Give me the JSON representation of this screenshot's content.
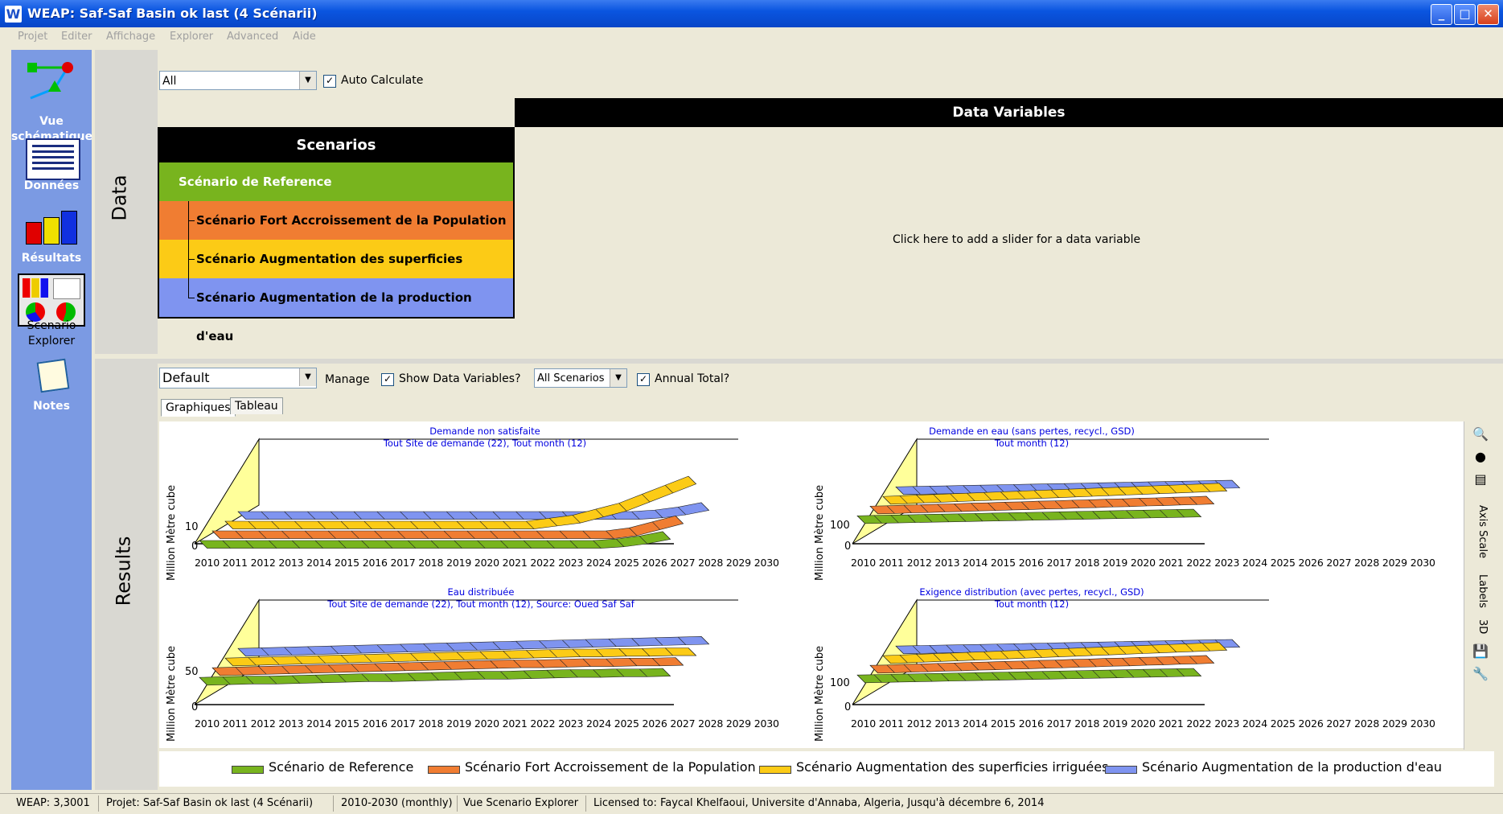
{
  "window": {
    "title": "WEAP: Saf-Saf  Basin ok last (4 Scénarii)",
    "logo_letter": "W"
  },
  "menu": [
    "Projet",
    "Editer",
    "Affichage",
    "Explorer",
    "Advanced",
    "Aide"
  ],
  "sidebar": {
    "items": [
      {
        "label": "Vue schématique",
        "icon": "schematic-icon"
      },
      {
        "label": "Données",
        "icon": "data-table-icon"
      },
      {
        "label": "Résultats",
        "icon": "bar-chart-icon"
      },
      {
        "label": "Scenario Explorer",
        "icon": "scenario-explorer-icon"
      },
      {
        "label": "Notes",
        "icon": "notes-icon"
      }
    ]
  },
  "data_section": {
    "label": "Data",
    "filter_value": "All",
    "auto_calculate_label": "Auto Calculate",
    "auto_calculate_checked": true,
    "data_variables_header": "Data Variables",
    "add_slider_hint": "Click here to add a slider for a data variable",
    "scenarios_title": "Scenarios",
    "scenarios": [
      {
        "name": "Scénario de Reference",
        "color": "#78b41e"
      },
      {
        "name": "Scénario Fort Accroissement de la Population",
        "color": "#f07d32"
      },
      {
        "name": "Scénario Augmentation des superficies irriguées",
        "color": "#fccb16"
      },
      {
        "name": "Scénario Augmentation de la production d'eau",
        "color": "#7f94f0"
      }
    ]
  },
  "results_section": {
    "label": "Results",
    "view_value": "Default",
    "manage_label": "Manage",
    "show_data_vars_label": "Show Data Variables?",
    "show_data_vars_checked": true,
    "scenario_filter_value": "All Scenarios",
    "annual_total_label": "Annual Total?",
    "annual_total_checked": true,
    "tabs": [
      "Graphiques",
      "Tableau"
    ],
    "active_tab": "Graphiques"
  },
  "charts": [
    {
      "title1": "Demande non satisfaite",
      "title2": "Tout Site de demande (22),  Tout month (12)",
      "ylabel": "Million Mètre cube",
      "ticks": [
        "10",
        "0"
      ]
    },
    {
      "title1": "Demande en eau (sans pertes, recycl., GSD)",
      "title2": "Tout month (12)",
      "ylabel": "Million Mètre cube",
      "ticks": [
        "100",
        "0"
      ]
    },
    {
      "title1": "Eau distribuée",
      "title2": "Tout Site de demande (22),  Tout month (12),  Source: Oued Saf Saf",
      "ylabel": "Million Mètre cube",
      "ticks": [
        "50",
        "0"
      ]
    },
    {
      "title1": "Exigence distribution (avec pertes, recycl., GSD)",
      "title2": "Tout month (12)",
      "ylabel": "Million Mètre cube",
      "ticks": [
        "100",
        "0"
      ]
    }
  ],
  "years": [
    "2010",
    "2011",
    "2012",
    "2013",
    "2014",
    "2015",
    "2016",
    "2017",
    "2018",
    "2019",
    "2020",
    "2021",
    "2022",
    "2023",
    "2024",
    "2025",
    "2026",
    "2027",
    "2028",
    "2029",
    "2030"
  ],
  "chart_data": [
    {
      "type": "area",
      "title": "Demande non satisfaite",
      "ylabel": "Million Mètre cube",
      "x": [
        "2010",
        "2011",
        "2012",
        "2013",
        "2014",
        "2015",
        "2016",
        "2017",
        "2018",
        "2019",
        "2020",
        "2021",
        "2022",
        "2023",
        "2024",
        "2025",
        "2026",
        "2027",
        "2028",
        "2029",
        "2030"
      ],
      "series": [
        {
          "name": "Scénario de Reference",
          "values": [
            0,
            0,
            0,
            0,
            0,
            0,
            0,
            0,
            0,
            0,
            0,
            0,
            0,
            0,
            0,
            0,
            0,
            0,
            0.5,
            1.5,
            3
          ]
        },
        {
          "name": "Scénario Fort Accroissement de la Population",
          "values": [
            0,
            0,
            0,
            0,
            0,
            0,
            0,
            0,
            0,
            0,
            0,
            0,
            0,
            0,
            0,
            0,
            0,
            0,
            1,
            3,
            5
          ]
        },
        {
          "name": "Scénario Augmentation des superficies irriguées",
          "values": [
            0,
            0,
            0,
            0,
            0,
            0,
            0,
            0,
            0,
            0,
            0,
            0,
            0,
            0,
            1,
            2,
            4,
            6,
            9,
            12,
            15
          ]
        },
        {
          "name": "Scénario Augmentation de la production d'eau",
          "values": [
            0,
            0,
            0,
            0,
            0,
            0,
            0,
            0,
            0,
            0,
            0,
            0,
            0,
            0,
            0,
            0,
            0,
            0,
            0.5,
            1.5,
            3
          ]
        }
      ]
    },
    {
      "type": "area",
      "title": "Demande en eau (sans pertes, recycl., GSD)",
      "ylabel": "Million Mètre cube",
      "x": [
        "2010",
        "2011",
        "2012",
        "2013",
        "2014",
        "2015",
        "2016",
        "2017",
        "2018",
        "2019",
        "2020",
        "2021",
        "2022",
        "2023",
        "2024",
        "2025",
        "2026",
        "2027",
        "2028",
        "2029",
        "2030"
      ],
      "series": [
        {
          "name": "Scénario de Reference",
          "values": [
            75,
            76,
            77,
            78,
            79,
            80,
            81,
            82,
            83,
            84,
            85,
            86,
            87,
            88,
            89,
            90,
            91,
            92,
            93,
            94,
            95
          ]
        },
        {
          "name": "Scénario Fort Accroissement de la Population",
          "values": [
            75,
            76,
            78,
            79,
            81,
            82,
            84,
            85,
            87,
            88,
            90,
            91,
            93,
            94,
            96,
            97,
            99,
            100,
            102,
            103,
            105
          ]
        },
        {
          "name": "Scénario Augmentation des superficies irriguées",
          "values": [
            75,
            77,
            79,
            81,
            83,
            85,
            87,
            89,
            91,
            93,
            95,
            97,
            99,
            101,
            103,
            105,
            107,
            109,
            111,
            113,
            115
          ]
        },
        {
          "name": "Scénario Augmentation de la production d'eau",
          "values": [
            75,
            76,
            77,
            78,
            79,
            80,
            81,
            82,
            83,
            84,
            85,
            86,
            87,
            88,
            89,
            90,
            91,
            92,
            93,
            94,
            95
          ]
        }
      ]
    },
    {
      "type": "area",
      "title": "Eau distribuée",
      "ylabel": "Million Mètre cube",
      "x": [
        "2010",
        "2011",
        "2012",
        "2013",
        "2014",
        "2015",
        "2016",
        "2017",
        "2018",
        "2019",
        "2020",
        "2021",
        "2022",
        "2023",
        "2024",
        "2025",
        "2026",
        "2027",
        "2028",
        "2029",
        "2030"
      ],
      "series": [
        {
          "name": "Scénario de Reference",
          "values": [
            40,
            41,
            42,
            42,
            43,
            44,
            45,
            46,
            46,
            47,
            48,
            49,
            50,
            50,
            51,
            52,
            53,
            53,
            54,
            54,
            55
          ]
        },
        {
          "name": "Scénario Fort Accroissement de la Population",
          "values": [
            40,
            41,
            42,
            43,
            44,
            45,
            46,
            47,
            48,
            49,
            50,
            51,
            52,
            53,
            53,
            54,
            55,
            55,
            56,
            56,
            57
          ]
        },
        {
          "name": "Scénario Augmentation des superficies irriguées",
          "values": [
            40,
            41,
            42,
            43,
            44,
            45,
            46,
            47,
            48,
            49,
            50,
            51,
            52,
            53,
            54,
            55,
            55,
            56,
            56,
            57,
            57
          ]
        },
        {
          "name": "Scénario Augmentation de la production d'eau",
          "values": [
            40,
            41,
            42,
            43,
            44,
            45,
            46,
            47,
            48,
            49,
            50,
            51,
            52,
            53,
            54,
            55,
            56,
            57,
            58,
            59,
            60
          ]
        }
      ]
    },
    {
      "type": "area",
      "title": "Exigence distribution (avec pertes, recycl., GSD)",
      "ylabel": "Million Mètre cube",
      "x": [
        "2010",
        "2011",
        "2012",
        "2013",
        "2014",
        "2015",
        "2016",
        "2017",
        "2018",
        "2019",
        "2020",
        "2021",
        "2022",
        "2023",
        "2024",
        "2025",
        "2026",
        "2027",
        "2028",
        "2029",
        "2030"
      ],
      "series": [
        {
          "name": "Scénario de Reference",
          "values": [
            80,
            81,
            82,
            83,
            84,
            85,
            86,
            87,
            88,
            89,
            90,
            91,
            92,
            93,
            94,
            95,
            96,
            97,
            98,
            99,
            100
          ]
        },
        {
          "name": "Scénario Fort Accroissement de la Population",
          "values": [
            80,
            81,
            83,
            84,
            86,
            87,
            89,
            90,
            92,
            93,
            95,
            96,
            98,
            99,
            101,
            102,
            104,
            105,
            107,
            108,
            110
          ]
        },
        {
          "name": "Scénario Augmentation des superficies irriguées",
          "values": [
            80,
            82,
            84,
            86,
            88,
            90,
            92,
            94,
            96,
            98,
            100,
            102,
            104,
            106,
            108,
            110,
            112,
            114,
            116,
            118,
            120
          ]
        },
        {
          "name": "Scénario Augmentation de la production d'eau",
          "values": [
            80,
            81,
            82,
            83,
            84,
            85,
            86,
            87,
            88,
            89,
            90,
            91,
            92,
            93,
            94,
            95,
            96,
            97,
            98,
            99,
            100
          ]
        }
      ]
    }
  ],
  "right_toolbar": [
    "Axis Scale",
    "Labels",
    "3D"
  ],
  "status": [
    "WEAP: 3,3001",
    "Projet: Saf-Saf  Basin ok last (4 Scénarii)",
    "2010-2030 (monthly)",
    "Vue Scenario Explorer",
    "Licensed to: Faycal Khelfaoui, Universite d'Annaba, Algeria, Jusqu'à décembre 6, 2014"
  ]
}
